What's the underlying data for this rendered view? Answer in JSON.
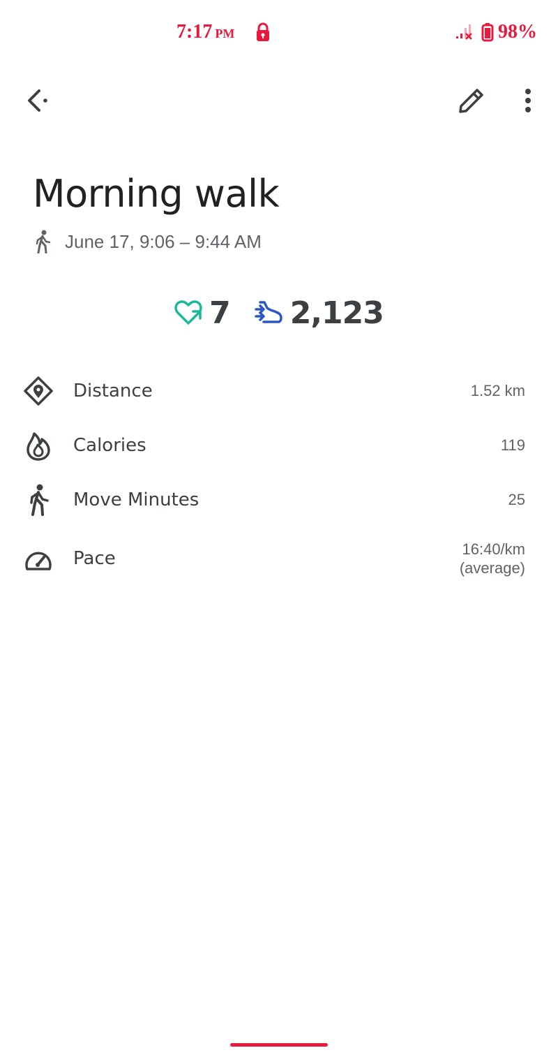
{
  "status_bar": {
    "time": "7:17",
    "ampm": "PM",
    "battery": "98%",
    "accent_color": "#e8193c"
  },
  "app_bar": {
    "back_icon": "back-arrow-icon",
    "edit_icon": "pencil-icon",
    "more_icon": "more-vert-icon"
  },
  "activity": {
    "title": "Morning walk",
    "datetime": "June 17, 9:06 – 9:44 AM",
    "heart_points": "7",
    "steps": "2,123",
    "heart_color": "#1ab99a",
    "steps_color": "#2a56c6"
  },
  "metrics": [
    {
      "icon": "location-diamond-icon",
      "label": "Distance",
      "value": "1.52 km"
    },
    {
      "icon": "flame-icon",
      "label": "Calories",
      "value": "119"
    },
    {
      "icon": "walking-person-icon",
      "label": "Move Minutes",
      "value": "25"
    },
    {
      "icon": "speedometer-icon",
      "label": "Pace",
      "value_line1": "16:40/km",
      "value_line2": "(average)"
    }
  ]
}
